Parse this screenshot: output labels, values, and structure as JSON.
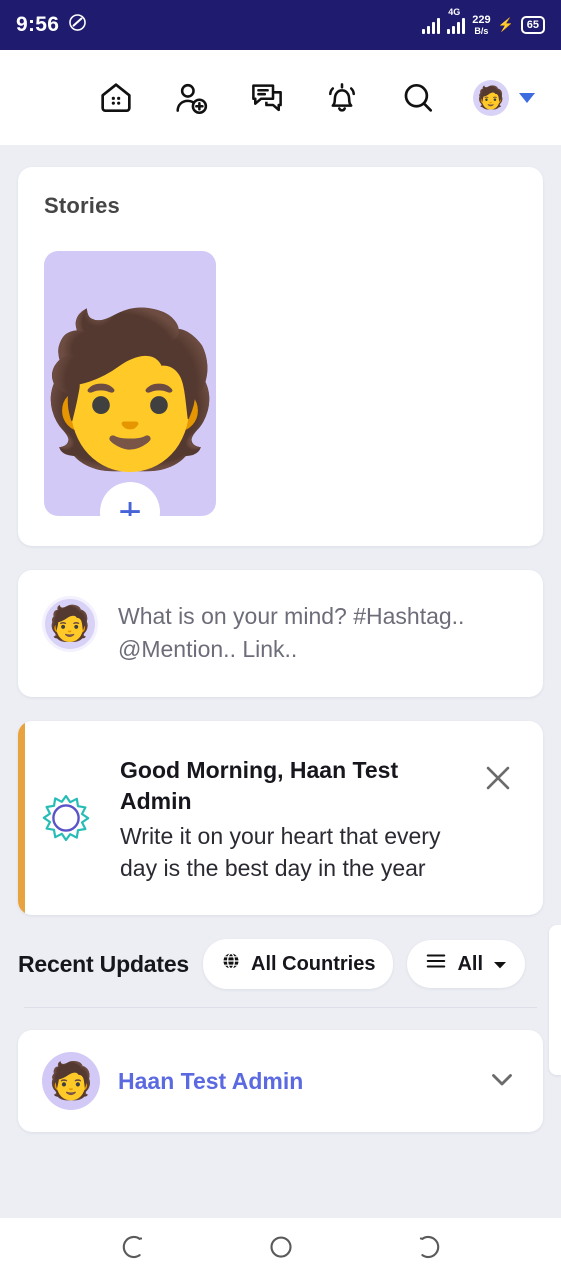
{
  "statusbar": {
    "time": "9:56",
    "dnd_icon": "do-not-disturb-icon",
    "network_type": "4G",
    "net_speed_value": "229",
    "net_speed_unit": "B/s",
    "battery": "65",
    "charging_icon": "charging-bolt-icon"
  },
  "topnav": {
    "menu_icon": "hamburger-menu-icon",
    "home_icon": "home-icon",
    "add_friend_icon": "add-person-icon",
    "messages_icon": "chat-bubble-icon",
    "notifications_icon": "bell-icon",
    "search_icon": "search-icon",
    "avatar_icon": "user-avatar",
    "avatar_face": "🧑",
    "caret_icon": "chevron-down-icon"
  },
  "stories": {
    "title": "Stories",
    "tile_face": "🧑",
    "add_label": "+"
  },
  "composer": {
    "avatar_face": "🧑",
    "placeholder": "What is on your mind? #Hashtag.. @Mention.. Link.."
  },
  "greeting": {
    "icon": "sun-icon",
    "title": "Good Morning, Haan Test Admin",
    "quote": "Write it on your heart that every day is the best day in the year",
    "close_icon": "close-icon",
    "accent_color": "#e9a33e"
  },
  "recent": {
    "title": "Recent Updates",
    "country_filter": {
      "icon": "globe-icon",
      "label": "All Countries"
    },
    "type_filter": {
      "icon": "list-icon",
      "label": "All",
      "caret": "caret-down-icon"
    }
  },
  "feed": {
    "post": {
      "avatar_face": "🧑",
      "author": "Haan Test Admin",
      "expand_icon": "chevron-down-icon"
    }
  },
  "botnav": {
    "back_icon": "back-icon",
    "home_icon": "home-circle-icon",
    "recents_icon": "recents-icon"
  }
}
